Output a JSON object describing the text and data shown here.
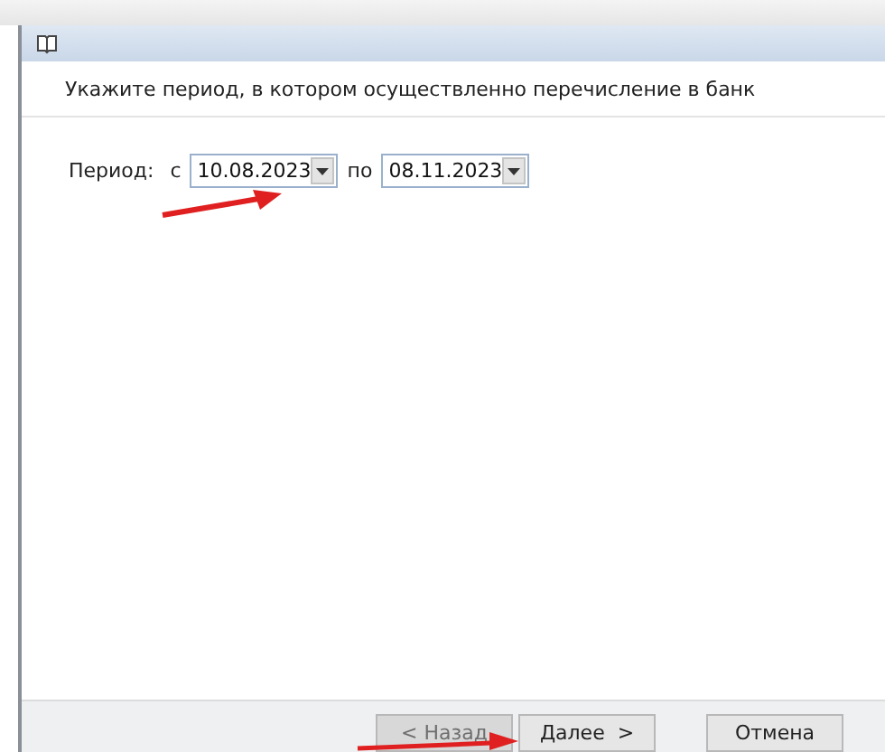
{
  "dialog": {
    "header": "Укажите период, в котором осуществленно перечисление в банк"
  },
  "period": {
    "label": "Период:",
    "from_label": "с",
    "from_value": "10.08.2023",
    "to_label": "по",
    "to_value": "08.11.2023"
  },
  "buttons": [
    {
      "label": "< Назад",
      "disabled": true
    },
    {
      "label": "Далее  >",
      "disabled": false
    },
    {
      "label": "Отмена",
      "disabled": false
    }
  ]
}
